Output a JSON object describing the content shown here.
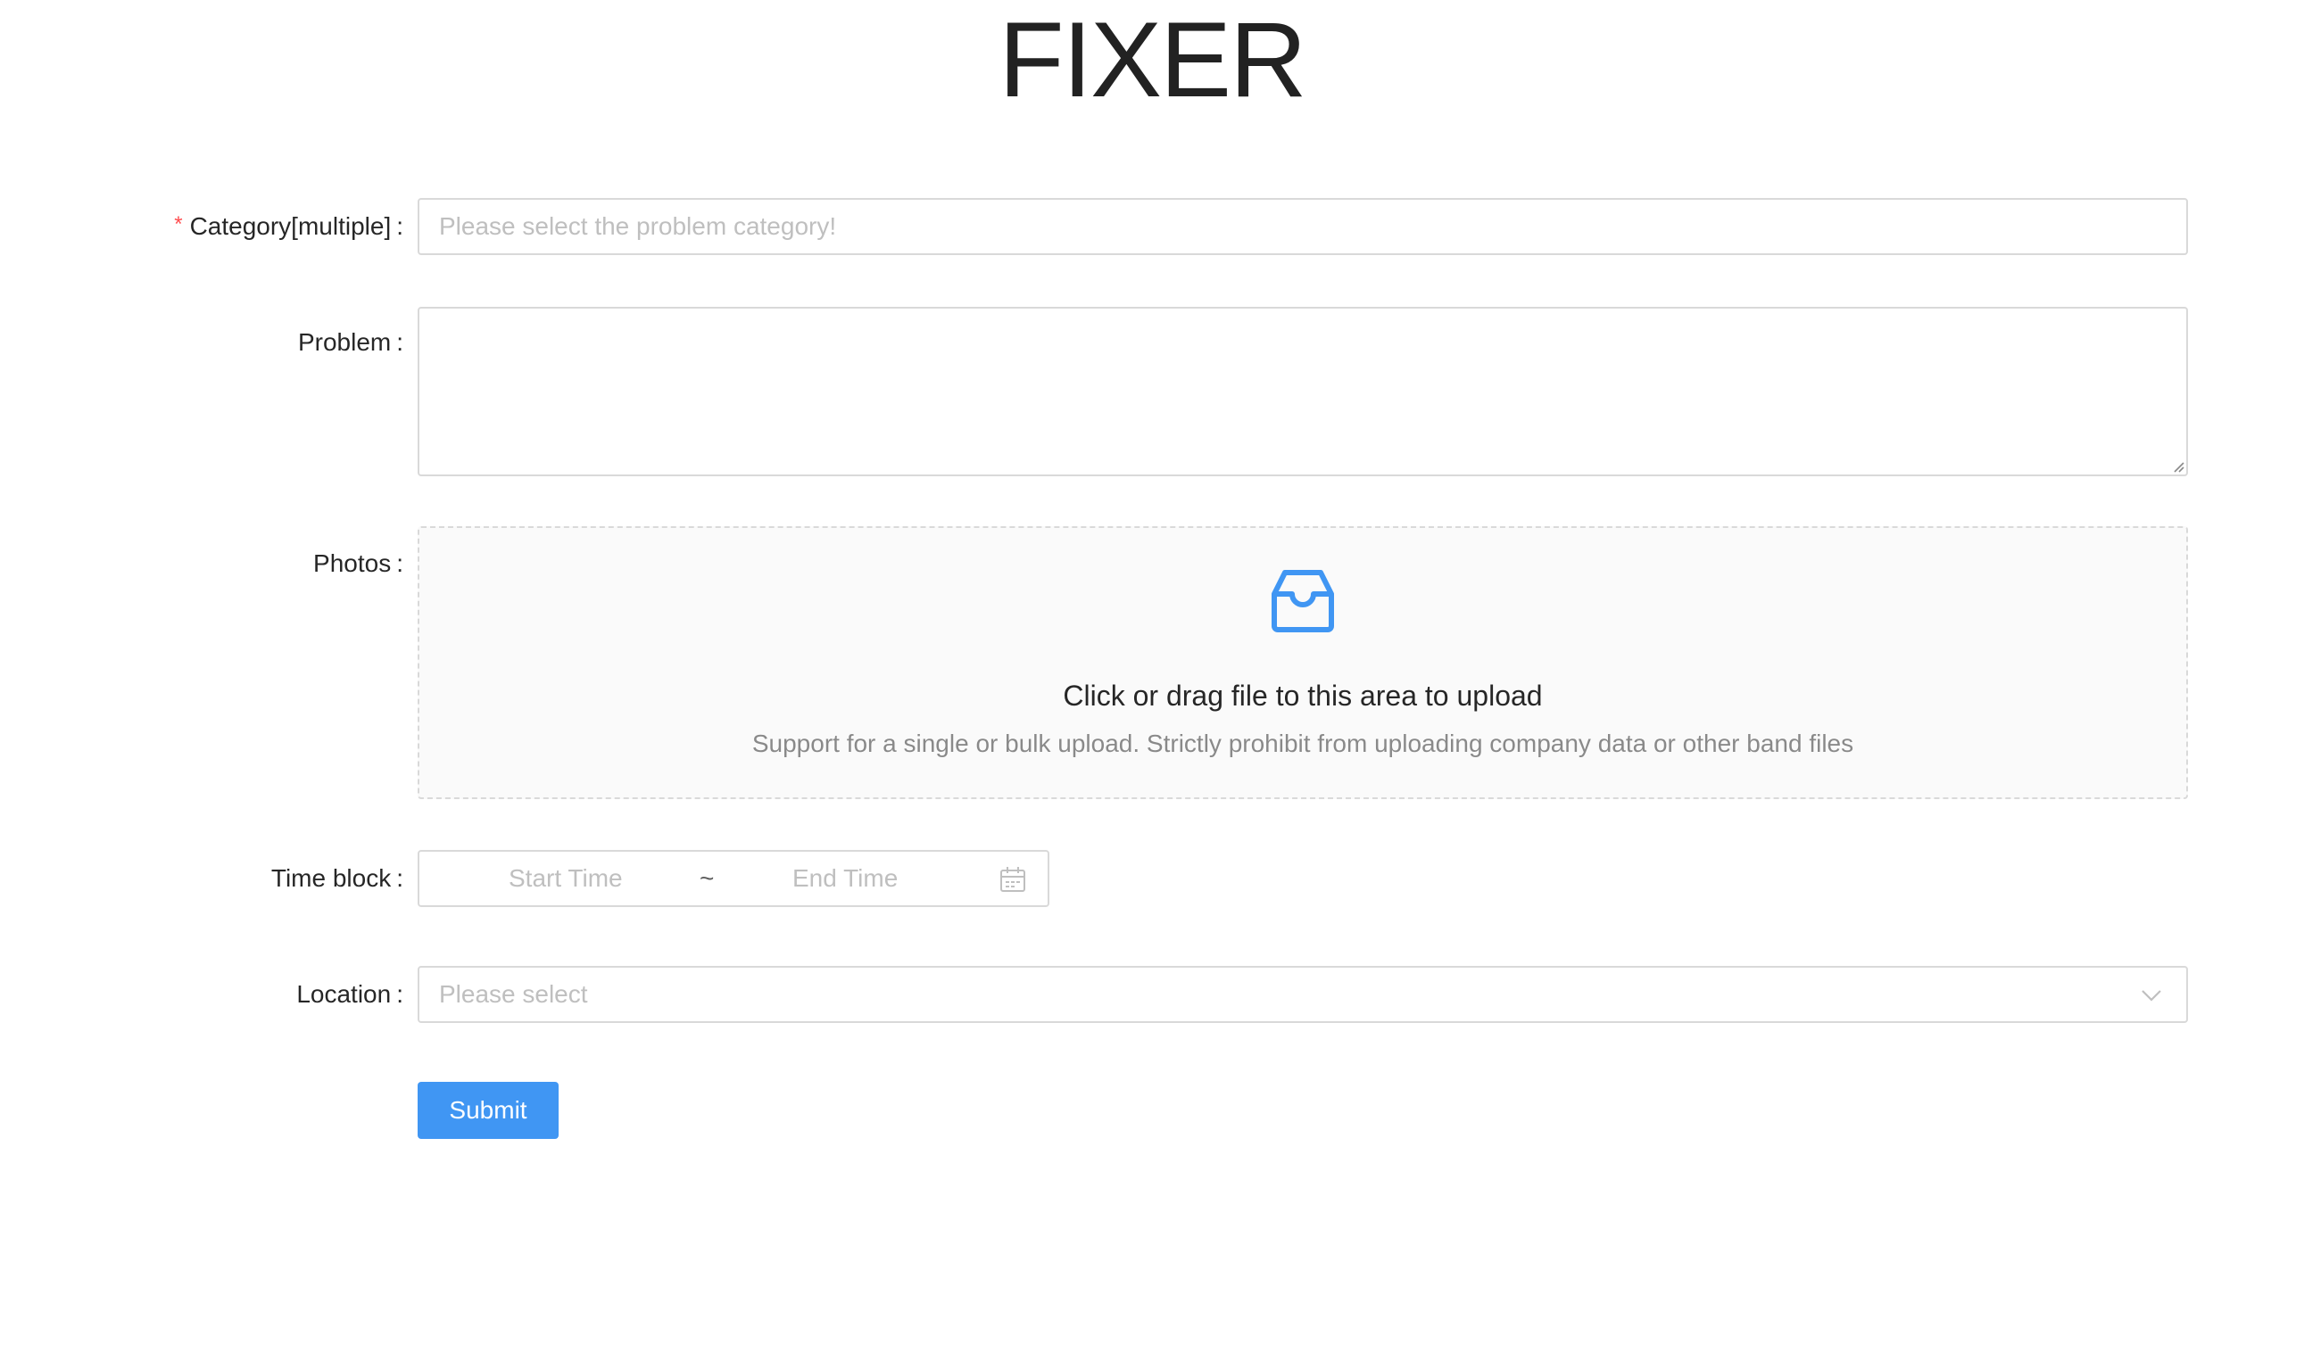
{
  "app": {
    "title": "FIXER"
  },
  "form": {
    "category": {
      "label": "Category[multiple]",
      "required": true,
      "placeholder": "Please select the problem category!"
    },
    "problem": {
      "label": "Problem",
      "value": ""
    },
    "photos": {
      "label": "Photos",
      "upload_text": "Click or drag file to this area to upload",
      "upload_hint": "Support for a single or bulk upload. Strictly prohibit from uploading company data or other band files",
      "icon": "inbox-icon"
    },
    "time_block": {
      "label": "Time block",
      "start_placeholder": "Start Time",
      "separator": "~",
      "end_placeholder": "End Time",
      "icon": "calendar-icon"
    },
    "location": {
      "label": "Location",
      "placeholder": "Please select",
      "icon": "chevron-down-icon"
    },
    "submit_label": "Submit"
  },
  "colors": {
    "primary": "#4096f3",
    "required": "#ff4d4f",
    "border": "#d9d9d9",
    "placeholder": "#bfbfbf",
    "title": "#222222"
  }
}
